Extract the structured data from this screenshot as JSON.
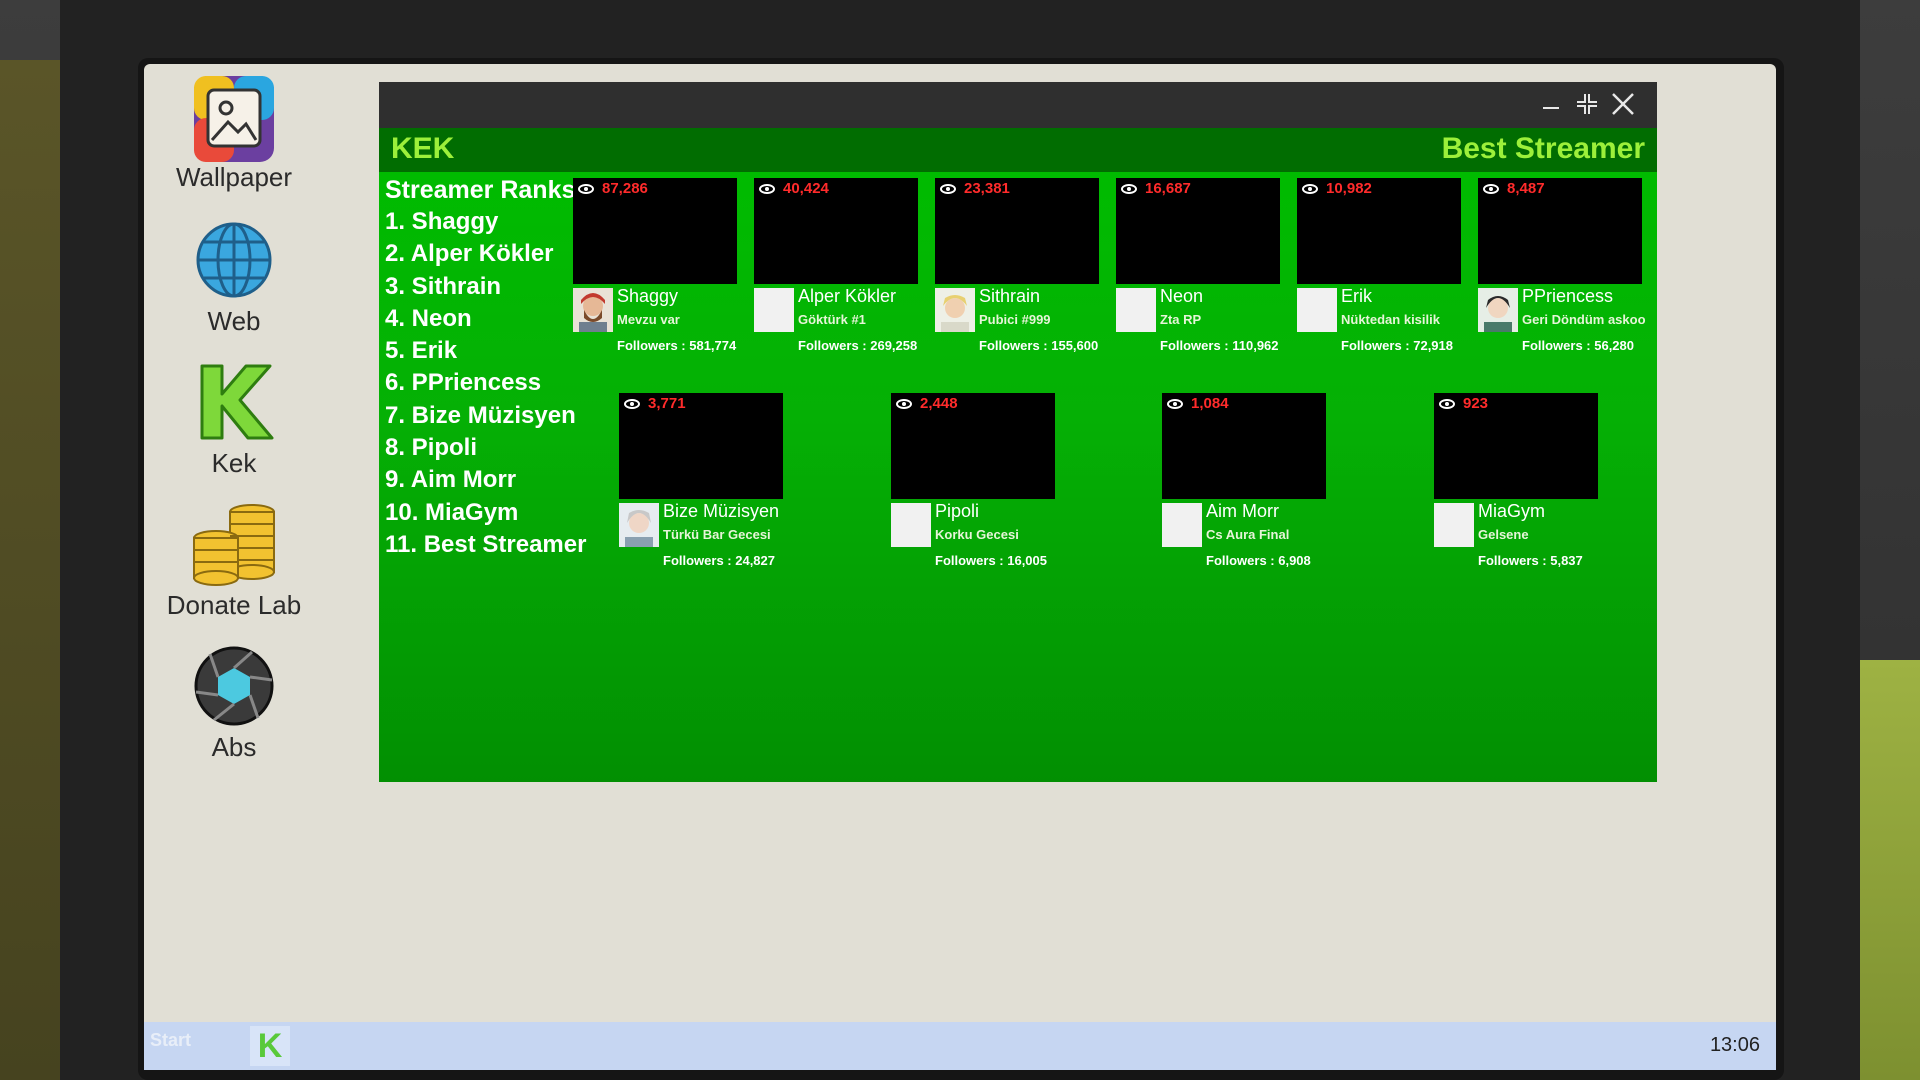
{
  "desktop": {
    "icons": [
      {
        "label": "Wallpaper",
        "icon": "wallpaper-icon"
      },
      {
        "label": "Web",
        "icon": "globe-icon"
      },
      {
        "label": "Kek",
        "icon": "kek-logo-icon"
      },
      {
        "label": "Donate Lab",
        "icon": "coins-icon"
      },
      {
        "label": "Abs",
        "icon": "aperture-icon"
      }
    ]
  },
  "window": {
    "brand": "KEK",
    "best_streamer_link": "Best Streamer",
    "controls": {
      "minimize": "–",
      "restore": "⊹",
      "close": "✕"
    }
  },
  "ranks": {
    "title": "Streamer Ranks",
    "items": [
      "1. Shaggy",
      "2. Alper Kökler",
      "3. Sithrain",
      "4. Neon",
      "5. Erik",
      "6. PPriencess",
      "7. Bize Müzisyen",
      "8. Pipoli",
      "9. Aim Morr",
      "10. MiaGym",
      "11. Best Streamer"
    ]
  },
  "streams": [
    {
      "viewers": "87,286",
      "name": "Shaggy",
      "title": "Mevzu var",
      "followers": "Followers : 581,774",
      "avatar": "bearded-avatar"
    },
    {
      "viewers": "40,424",
      "name": "Alper Kökler",
      "title": "Göktürk #1",
      "followers": "Followers : 269,258",
      "avatar": "blank"
    },
    {
      "viewers": "23,381",
      "name": "Sithrain",
      "title": "Pubici #999",
      "followers": "Followers : 155,600",
      "avatar": "blonde-avatar"
    },
    {
      "viewers": "16,687",
      "name": "Neon",
      "title": "Zta RP",
      "followers": "Followers : 110,962",
      "avatar": "blank"
    },
    {
      "viewers": "10,982",
      "name": "Erik",
      "title": "Nüktedan kisilik",
      "followers": "Followers : 72,918",
      "avatar": "blank"
    },
    {
      "viewers": "8,487",
      "name": "PPriencess",
      "title": "Geri Döndüm askoo",
      "followers": "Followers : 56,280",
      "avatar": "dark-hair-avatar"
    },
    {
      "viewers": "3,771",
      "name": "Bize Müzisyen",
      "title": "Türkü Bar Gecesi",
      "followers": "Followers : 24,827",
      "avatar": "grey-hair-avatar"
    },
    {
      "viewers": "2,448",
      "name": "Pipoli",
      "title": "Korku Gecesi",
      "followers": "Followers : 16,005",
      "avatar": "blank"
    },
    {
      "viewers": "1,084",
      "name": "Aim Morr",
      "title": "Cs Aura Final",
      "followers": "Followers : 6,908",
      "avatar": "blank"
    },
    {
      "viewers": "923",
      "name": "MiaGym",
      "title": "Gelsene",
      "followers": "Followers : 5,837",
      "avatar": "blank"
    }
  ],
  "taskbar": {
    "start_label": "Start",
    "pinned_app": "K",
    "clock": "13:06"
  },
  "colors": {
    "accent_green": "#00a000",
    "header_green": "#016d01",
    "brand_lime": "#9cf03a",
    "viewer_red": "#ff2b2b",
    "taskbar_blue": "#c6d6f2"
  }
}
